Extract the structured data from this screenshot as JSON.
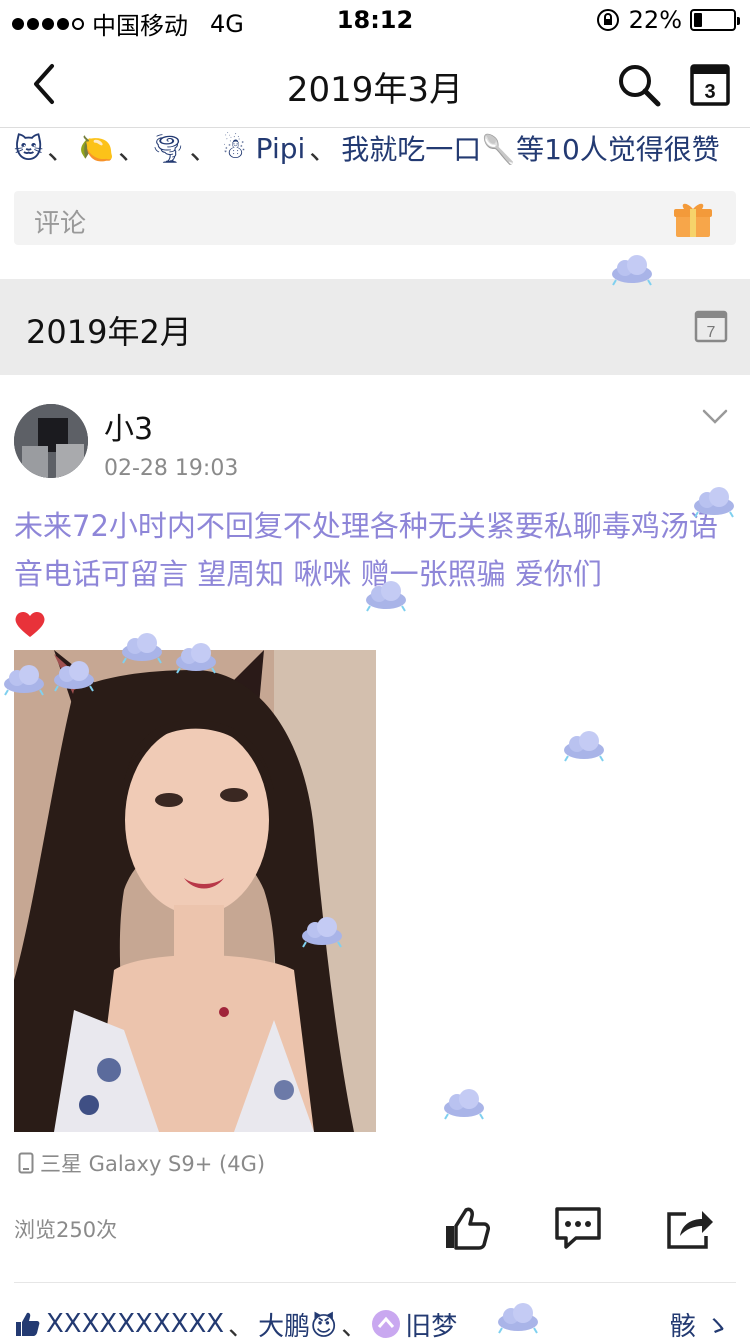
{
  "status": {
    "carrier": "中国移动",
    "network": "4G",
    "time": "18:12",
    "battery": "22%",
    "battery_level": 0.22
  },
  "nav": {
    "title": "2019年3月",
    "calendar_day": "3"
  },
  "likes_row": {
    "names": [
      "🐱",
      "🍋",
      "🌪",
      "☃ Pipi",
      "我就吃一口🥄"
    ],
    "suffix": "等10人觉得很赞"
  },
  "comment": {
    "placeholder": "评论"
  },
  "section": {
    "label": "2019年2月",
    "calendar_day": "7"
  },
  "post": {
    "author": "小3",
    "time": "02-28 19:03",
    "text": "未来72小时内不回复不处理各种无关紧要私聊毒鸡汤语音电话可留言 望周知 啾咪 赠一张照骗 爱你们",
    "device": "三星 Galaxy S9+ (4G)",
    "views": "浏览250次"
  },
  "likes_row2": {
    "names": [
      "XXXXXXXXXX",
      "大鹏😈",
      "旧梦",
      "骸 ゝ"
    ]
  },
  "colors": {
    "link": "#233a72",
    "post_text": "#8e86d8",
    "section_bg": "#ebebeb",
    "muted": "#8a8a8a"
  }
}
